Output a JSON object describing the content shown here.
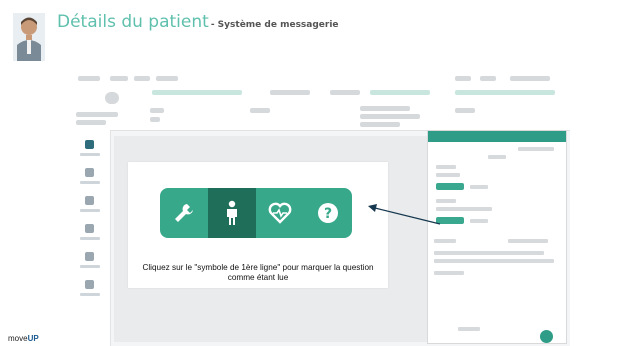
{
  "slide": {
    "title": "Détails du patient",
    "subtitle": "- Système de messagerie",
    "brand_prefix": "move",
    "brand_suffix": "UP"
  },
  "callout": {
    "caption": "Cliquez sur le \"symbole de 1ère ligne\" pour marquer la question comme étant lue",
    "toolbar": [
      {
        "name": "wrench-tool-button",
        "icon": "wrench-icon"
      },
      {
        "name": "first-line-symbol-button",
        "icon": "person-icon",
        "active": true
      },
      {
        "name": "heartbeat-tool-button",
        "icon": "heart-pulse-icon"
      },
      {
        "name": "help-tool-button",
        "icon": "question-icon"
      }
    ]
  },
  "colors": {
    "accent": "#5fc0ad",
    "toolbar": "#37a88a",
    "toolbar_active": "#1f6e5a",
    "panel_header": "#2e9c86",
    "brand": "#1a5b8f"
  }
}
